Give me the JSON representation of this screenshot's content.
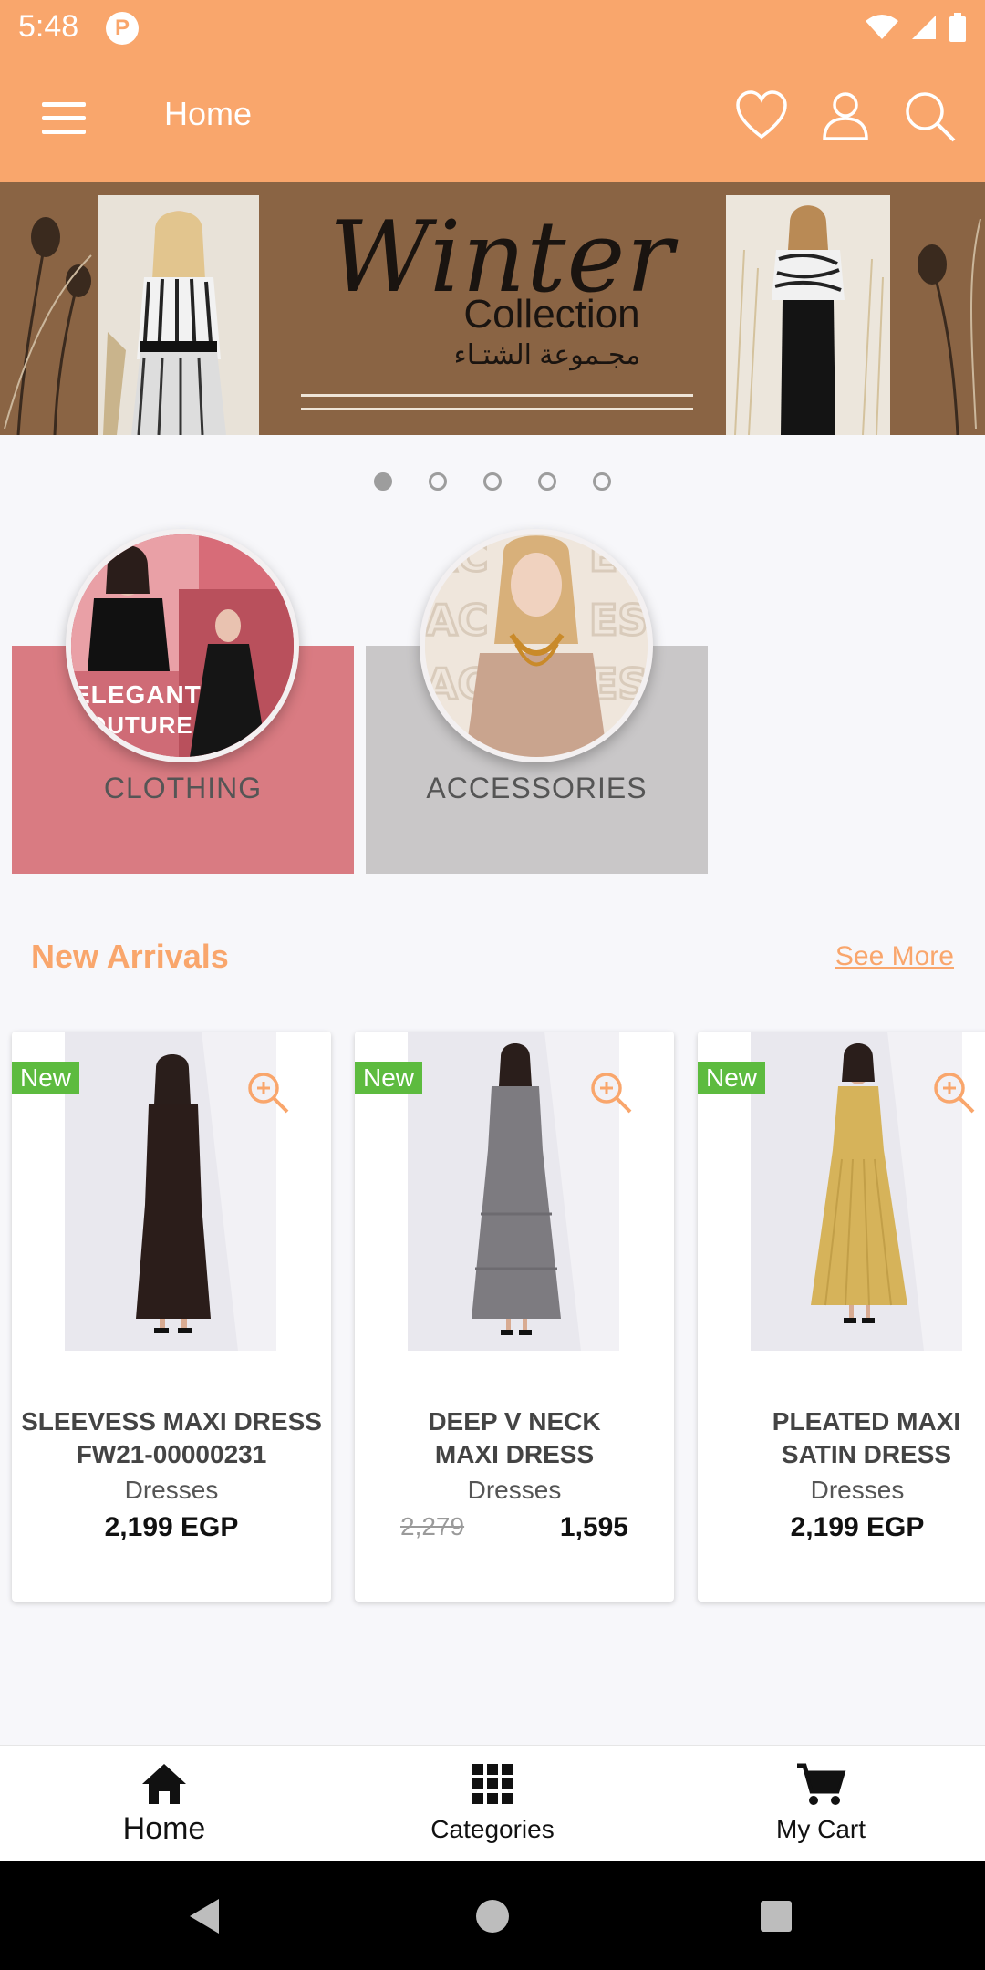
{
  "status_bar": {
    "time": "5:48",
    "app_icon": "P"
  },
  "app_bar": {
    "title": "Home"
  },
  "banner": {
    "title": "Winter",
    "subtitle": "Collection",
    "arabic_text": "مجـموعة الشتـاء",
    "dots_count": 5,
    "active_dot": 0
  },
  "categories": [
    {
      "label": "CLOTHING",
      "color": "#d97b82",
      "circle_text_1": "ELEGANT",
      "circle_text_2": "OUTURE"
    },
    {
      "label": "ACCESSORIES",
      "color": "#c9c7c8"
    }
  ],
  "new_arrivals": {
    "title": "New Arrivals",
    "see_more": "See More"
  },
  "products": [
    {
      "badge": "New",
      "name_line1": "SLEEVESS MAXI DRESS",
      "name_line2": "FW21-00000231",
      "category": "Dresses",
      "price": "2,199 EGP",
      "dress_color": "#2b1d1a"
    },
    {
      "badge": "New",
      "name_line1": "DEEP V NECK",
      "name_line2": "MAXI DRESS",
      "category": "Dresses",
      "old_price": "2,279",
      "new_price": "1,595",
      "dress_color": "#7d7b80"
    },
    {
      "badge": "New",
      "name_line1": "PLEATED MAXI",
      "name_line2": "SATIN DRESS",
      "category": "Dresses",
      "price": "2,199 EGP",
      "dress_color": "#d6b35a"
    }
  ],
  "bottom_nav": {
    "items": [
      {
        "label": "Home",
        "icon": "home-icon",
        "active": true
      },
      {
        "label": "Categories",
        "icon": "grid-icon",
        "active": false
      },
      {
        "label": "My Cart",
        "icon": "cart-icon",
        "active": false
      }
    ]
  },
  "colors": {
    "accent": "#f9a66c",
    "badge_green": "#5dbb3f",
    "clothing_card": "#d97b82",
    "accessories_card": "#c9c7c8"
  }
}
